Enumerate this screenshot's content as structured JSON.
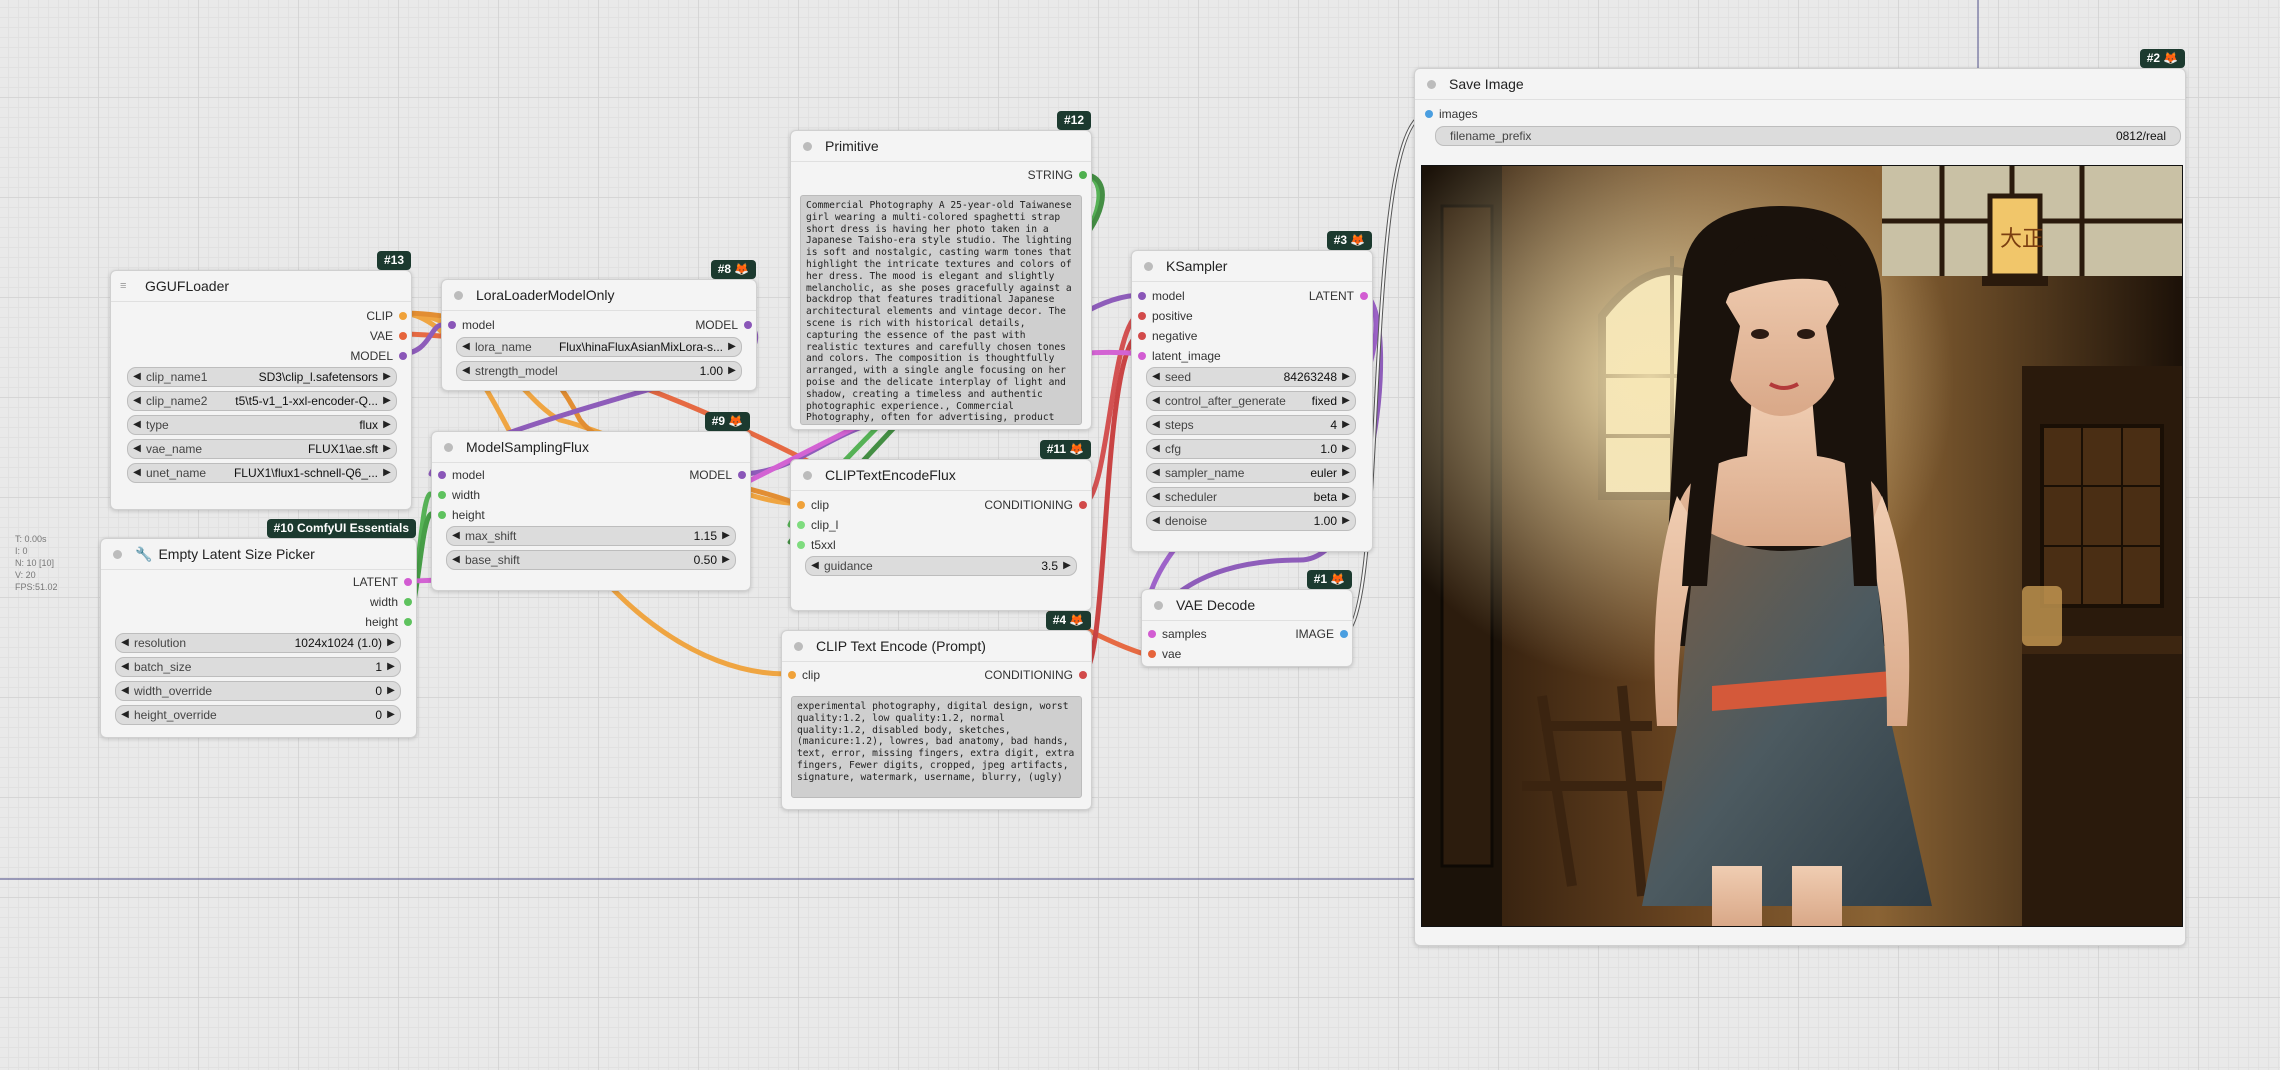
{
  "stats": [
    "T: 0.00s",
    "I: 0",
    "N: 10 [10]",
    "V: 20",
    "FPS:51.02"
  ],
  "colors": {
    "model": "#8a56b8",
    "clip": "#f0a23a",
    "vae": "#e6643b",
    "latent": "#d25cd2",
    "conditioning": "#d24a4a",
    "int": "#5ec25e",
    "string": "#4fb04f",
    "image": "#4a9ee0",
    "badge_bg": "#1c3a2f"
  },
  "nodes": {
    "gguf": {
      "id": "#13",
      "title": "GGUFLoader",
      "outputs": [
        "CLIP",
        "VAE",
        "MODEL"
      ],
      "widgets": [
        {
          "label": "clip_name1",
          "value": "SD3\\clip_l.safetensors"
        },
        {
          "label": "clip_name2",
          "value": "t5\\t5-v1_1-xxl-encoder-Q..."
        },
        {
          "label": "type",
          "value": "flux"
        },
        {
          "label": "vae_name",
          "value": "FLUX1\\ae.sft"
        },
        {
          "label": "unet_name",
          "value": "FLUX1\\flux1-schnell-Q6_..."
        }
      ]
    },
    "lora": {
      "id": "#8",
      "title": "LoraLoaderModelOnly",
      "input": "model",
      "output": "MODEL",
      "widgets": [
        {
          "label": "lora_name",
          "value": "Flux\\hinaFluxAsianMixLora-s..."
        },
        {
          "label": "strength_model",
          "value": "1.00"
        }
      ]
    },
    "msf": {
      "id": "#9",
      "title": "ModelSamplingFlux",
      "inputs": [
        "model",
        "width",
        "height"
      ],
      "output": "MODEL",
      "widgets": [
        {
          "label": "max_shift",
          "value": "1.15"
        },
        {
          "label": "base_shift",
          "value": "0.50"
        }
      ]
    },
    "latent": {
      "id": "#10 ComfyUI Essentials",
      "title": "Empty Latent Size Picker",
      "outputs": [
        "LATENT",
        "width",
        "height"
      ],
      "widgets": [
        {
          "label": "resolution",
          "value": "1024x1024 (1.0)"
        },
        {
          "label": "batch_size",
          "value": "1"
        },
        {
          "label": "width_override",
          "value": "0"
        },
        {
          "label": "height_override",
          "value": "0"
        }
      ]
    },
    "primitive": {
      "id": "#12",
      "title": "Primitive",
      "output": "STRING",
      "text": "Commercial Photography A 25-year-old Taiwanese girl wearing a multi-colored spaghetti strap short dress is having her photo taken in a Japanese Taisho-era style studio. The lighting is soft and nostalgic, casting warm tones that highlight the intricate textures and colors of her dress. The mood is elegant and slightly melancholic, as she poses gracefully against a backdrop that features traditional Japanese architectural elements and vintage decor. The scene is rich with historical details, capturing the essence of the past with realistic textures and carefully chosen tones and colors. The composition is thoughtfully arranged, with a single angle focusing on her poise and the delicate interplay of light and shadow, creating a timeless and authentic photographic experience., Commercial Photography, often for advertising, product shots, or business imagery."
    },
    "clipflux": {
      "id": "#11",
      "title": "CLIPTextEncodeFlux",
      "inputs": [
        "clip",
        "clip_l",
        "t5xxl"
      ],
      "output": "CONDITIONING",
      "widgets": [
        {
          "label": "guidance",
          "value": "3.5"
        }
      ]
    },
    "cliptext": {
      "id": "#4",
      "title": "CLIP Text Encode (Prompt)",
      "input": "clip",
      "output": "CONDITIONING",
      "text": "experimental photography, digital design, worst quality:1.2, low quality:1.2, normal quality:1.2, disabled body, sketches, (manicure:1.2), lowres, bad anatomy, bad hands, text, error, missing fingers, extra digit, extra fingers, Fewer digits, cropped, jpeg artifacts, signature, watermark, username, blurry, (ugly)"
    },
    "ksampler": {
      "id": "#3",
      "title": "KSampler",
      "inputs": [
        "model",
        "positive",
        "negative",
        "latent_image"
      ],
      "output": "LATENT",
      "widgets": [
        {
          "label": "seed",
          "value": "84263248"
        },
        {
          "label": "control_after_generate",
          "value": "fixed"
        },
        {
          "label": "steps",
          "value": "4"
        },
        {
          "label": "cfg",
          "value": "1.0"
        },
        {
          "label": "sampler_name",
          "value": "euler"
        },
        {
          "label": "scheduler",
          "value": "beta"
        },
        {
          "label": "denoise",
          "value": "1.00"
        }
      ]
    },
    "vae": {
      "id": "#1",
      "title": "VAE Decode",
      "inputs": [
        "samples",
        "vae"
      ],
      "output": "IMAGE"
    },
    "save": {
      "id": "#2",
      "title": "Save Image",
      "input": "images",
      "widgets": [
        {
          "label": "filename_prefix",
          "value": "0812/real"
        }
      ],
      "preview_caption": "大正"
    }
  }
}
